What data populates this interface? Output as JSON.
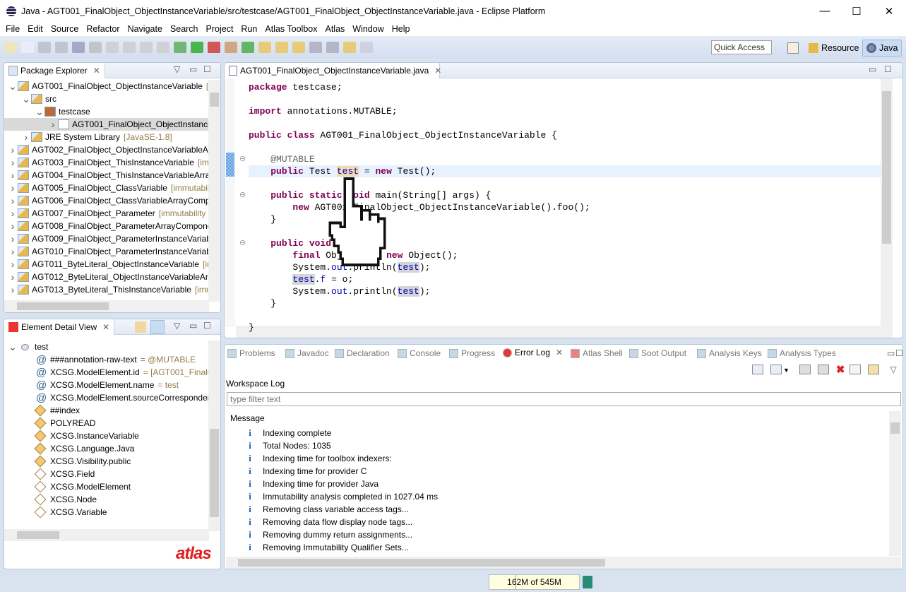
{
  "window": {
    "title": "Java - AGT001_FinalObject_ObjectInstanceVariable/src/testcase/AGT001_FinalObject_ObjectInstanceVariable.java - Eclipse Platform",
    "minimize": "—",
    "maximize": "☐",
    "close": "✕"
  },
  "menu": [
    "File",
    "Edit",
    "Source",
    "Refactor",
    "Navigate",
    "Search",
    "Project",
    "Run",
    "Atlas Toolbox",
    "Atlas",
    "Window",
    "Help"
  ],
  "toolbar": {
    "quick_access": "Quick Access",
    "perspectives": [
      "Resource",
      "Java"
    ]
  },
  "package_explorer": {
    "title": "Package Explorer",
    "items": [
      {
        "level": 0,
        "arrow": "v",
        "label": "AGT001_FinalObject_ObjectInstanceVariable",
        "decor": "[i"
      },
      {
        "level": 1,
        "arrow": "v",
        "label": "src",
        "decor": ""
      },
      {
        "level": 2,
        "arrow": "v",
        "label": "testcase",
        "decor": ""
      },
      {
        "level": 3,
        "arrow": ">",
        "label": "AGT001_FinalObject_ObjectInstance",
        "decor": "",
        "selected": true
      },
      {
        "level": 1,
        "arrow": ">",
        "label": "JRE System Library",
        "decor": "[JavaSE-1.8]"
      },
      {
        "level": 0,
        "arrow": ">",
        "label": "AGT002_FinalObject_ObjectInstanceVariableAr",
        "decor": ""
      },
      {
        "level": 0,
        "arrow": ">",
        "label": "AGT003_FinalObject_ThisInstanceVariable",
        "decor": "[im"
      },
      {
        "level": 0,
        "arrow": ">",
        "label": "AGT004_FinalObject_ThisInstanceVariableArray",
        "decor": ""
      },
      {
        "level": 0,
        "arrow": ">",
        "label": "AGT005_FinalObject_ClassVariable",
        "decor": "[immutabil"
      },
      {
        "level": 0,
        "arrow": ">",
        "label": "AGT006_FinalObject_ClassVariableArrayCompo",
        "decor": ""
      },
      {
        "level": 0,
        "arrow": ">",
        "label": "AGT007_FinalObject_Parameter",
        "decor": "[immutability"
      },
      {
        "level": 0,
        "arrow": ">",
        "label": "AGT008_FinalObject_ParameterArrayCompone",
        "decor": ""
      },
      {
        "level": 0,
        "arrow": ">",
        "label": "AGT009_FinalObject_ParameterInstanceVariabl",
        "decor": ""
      },
      {
        "level": 0,
        "arrow": ">",
        "label": "AGT010_FinalObject_ParameterInstanceVariabl",
        "decor": ""
      },
      {
        "level": 0,
        "arrow": ">",
        "label": "AGT011_ByteLiteral_ObjectInstanceVariable",
        "decor": "[ir"
      },
      {
        "level": 0,
        "arrow": ">",
        "label": "AGT012_ByteLiteral_ObjectInstanceVariableArr",
        "decor": ""
      },
      {
        "level": 0,
        "arrow": ">",
        "label": "AGT013_ByteLiteral_ThisInstanceVariable",
        "decor": "[imn"
      }
    ]
  },
  "element_detail": {
    "title": "Element Detail View",
    "root": "test",
    "attributes": [
      {
        "key": "###annotation-raw-text",
        "value": "= @MUTABLE"
      },
      {
        "key": "XCSG.ModelElement.id",
        "value": "= [AGT001_FinalOb"
      },
      {
        "key": "XCSG.ModelElement.name",
        "value": "= test"
      },
      {
        "key": "XCSG.ModelElement.sourceCorrespondenc",
        "value": ""
      }
    ],
    "tags": [
      {
        "label": "##index",
        "filled": true
      },
      {
        "label": "POLYREAD",
        "filled": true
      },
      {
        "label": "XCSG.InstanceVariable",
        "filled": true
      },
      {
        "label": "XCSG.Language.Java",
        "filled": true
      },
      {
        "label": "XCSG.Visibility.public",
        "filled": true
      },
      {
        "label": "XCSG.Field",
        "filled": false
      },
      {
        "label": "XCSG.ModelElement",
        "filled": false
      },
      {
        "label": "XCSG.Node",
        "filled": false
      },
      {
        "label": "XCSG.Variable",
        "filled": false
      }
    ],
    "logo": "atlas"
  },
  "editor": {
    "tab": "AGT001_FinalObject_ObjectInstanceVariable.java",
    "lines": [
      [
        [
          "package",
          "kw"
        ],
        [
          " testcase;",
          ""
        ]
      ],
      [],
      [
        [
          "import",
          "kw"
        ],
        [
          " annotations.MUTABLE;",
          ""
        ]
      ],
      [],
      [
        [
          "public class",
          "kw"
        ],
        [
          " AGT001_FinalObject_ObjectInstanceVariable {",
          ""
        ]
      ],
      [],
      [
        [
          "    ",
          ""
        ],
        [
          "@MUTABLE",
          "ann"
        ]
      ],
      [
        [
          "    ",
          ""
        ],
        [
          "public",
          "kw"
        ],
        [
          " Test ",
          ""
        ],
        [
          "test",
          "fld wocc"
        ],
        [
          " = ",
          ""
        ],
        [
          "new",
          "kw"
        ],
        [
          " Test();",
          ""
        ]
      ],
      [],
      [
        [
          "    ",
          ""
        ],
        [
          "public static void",
          "kw"
        ],
        [
          " main(String[] args) {",
          ""
        ]
      ],
      [
        [
          "        ",
          ""
        ],
        [
          "new",
          "kw"
        ],
        [
          " AGT001_FinalObject_ObjectInstanceVariable().foo();",
          ""
        ]
      ],
      [
        [
          "    }",
          ""
        ]
      ],
      [],
      [
        [
          "    ",
          ""
        ],
        [
          "public void",
          "kw"
        ],
        [
          " foo() {",
          ""
        ]
      ],
      [
        [
          "        ",
          ""
        ],
        [
          "final",
          "kw"
        ],
        [
          " Object o = ",
          ""
        ],
        [
          "new",
          "kw"
        ],
        [
          " Object();",
          ""
        ]
      ],
      [
        [
          "        System.",
          ""
        ],
        [
          "out",
          "fld"
        ],
        [
          ".println(",
          ""
        ],
        [
          "test",
          "fld occ"
        ],
        [
          ");",
          ""
        ]
      ],
      [
        [
          "        ",
          ""
        ],
        [
          "test",
          "fld occ"
        ],
        [
          ".",
          ""
        ],
        [
          "f",
          "fld"
        ],
        [
          " = o;",
          ""
        ]
      ],
      [
        [
          "        System.",
          ""
        ],
        [
          "out",
          "fld"
        ],
        [
          ".println(",
          ""
        ],
        [
          "test",
          "fld occ"
        ],
        [
          ");",
          ""
        ]
      ],
      [
        [
          "    }",
          ""
        ]
      ],
      [],
      [
        [
          "}",
          ""
        ]
      ]
    ]
  },
  "bottom": {
    "tabs": [
      "Problems",
      "Javadoc",
      "Declaration",
      "Console",
      "Progress",
      "Error Log",
      "Atlas Shell",
      "Soot Output",
      "Analysis Keys",
      "Analysis Types"
    ],
    "active_tab": "Error Log",
    "workspace_label": "Workspace Log",
    "filter_placeholder": "type filter text",
    "column": "Message",
    "messages": [
      "Indexing complete",
      "Total Nodes: 1035",
      "Indexing time for toolbox indexers:",
      "Indexing time for provider C",
      "Indexing time for provider Java",
      "Immutability analysis completed in 1027.04 ms",
      "Removing class variable access tags...",
      "Removing data flow display node tags...",
      "Removing dummy return assignments...",
      "Removing Immutability Qualifier Sets..."
    ]
  },
  "status": {
    "heap": "162M of 545M",
    "heap_used_fraction": 0.297
  }
}
